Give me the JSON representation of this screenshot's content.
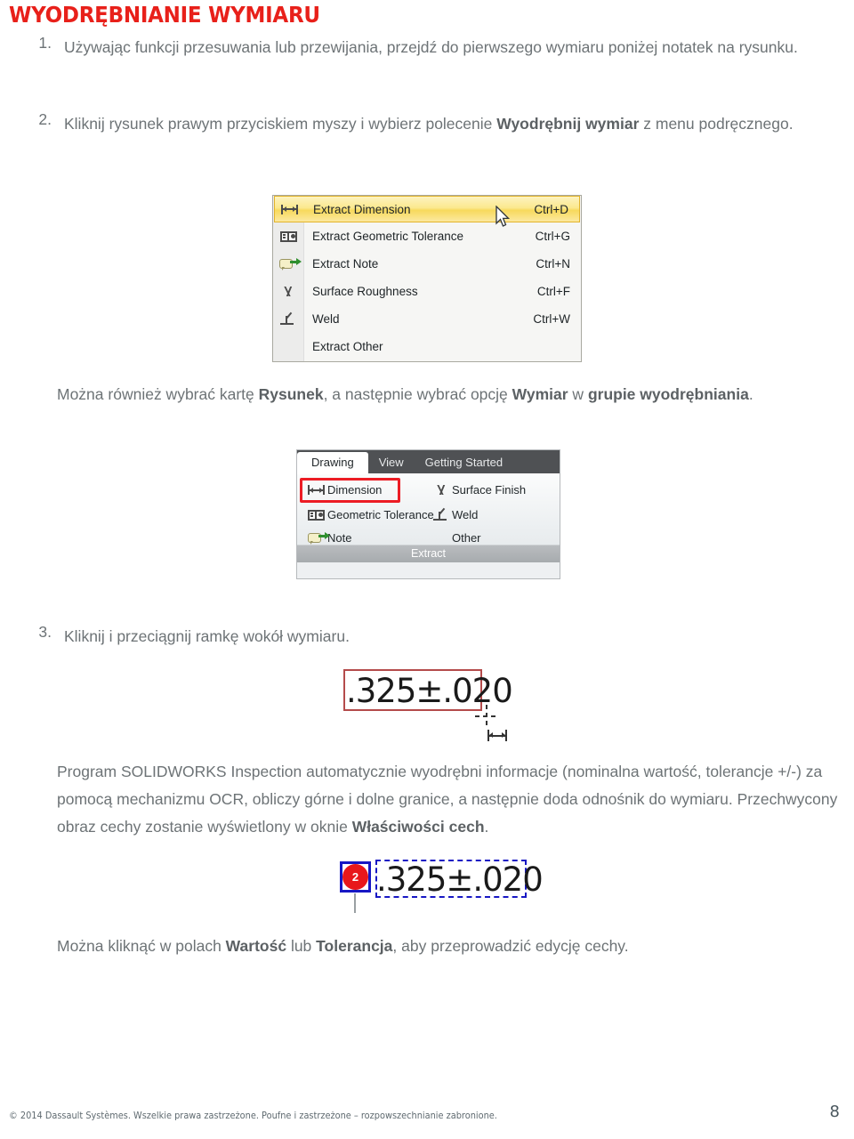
{
  "document": {
    "title": "WYODRĘBNIANIE WYMIARU",
    "title_color": "#e8201a",
    "page_number": "8",
    "footer": "© 2014 Dassault Systèmes. Wszelkie prawa zastrzeżone. Poufne i zastrzeżone – rozpowszechnianie zabronione."
  },
  "steps": [
    {
      "number": "1.",
      "text_before": "Używając funkcji przesuwania lub przewijania, przejdź do pierwszego wymiaru poniżej notatek na rysunku."
    },
    {
      "number": "2.",
      "text_before": "Kliknij rysunek prawym przyciskiem myszy i wybierz polecenie ",
      "bold": "Wyodrębnij wymiar",
      "text_after": " z menu podręcznego."
    },
    {
      "number": "3.",
      "text_before": "Kliknij i przeciągnij ramkę wokół wymiaru."
    }
  ],
  "paragraphs": {
    "ribbon_hint": {
      "p1": "Można również wybrać kartę ",
      "b1": "Rysunek",
      "p2": ", a następnie wybrać opcję ",
      "b2": "Wymiar",
      "p3": " w ",
      "b3": "grupie wyodrębniania",
      "p4": "."
    },
    "ocr_info": {
      "p1": "Program SOLIDWORKS Inspection automatycznie wyodrębni informacje (nominalna wartość, tolerancje +/-) za pomocą mechanizmu OCR, obliczy górne i dolne granice, a następnie doda odnośnik do wymiaru. Przechwycony obraz cechy zostanie wyświetlony w oknie ",
      "b1": "Właściwości cech",
      "p2": "."
    },
    "edit_hint": {
      "p1": "Można kliknąć w polach ",
      "b1": "Wartość",
      "p2": " lub ",
      "b2": "Tolerancja",
      "p3": ", aby przeprowadzić edycję cechy."
    }
  },
  "context_menu": {
    "highlight_color": "#f7d95c",
    "items": [
      {
        "icon": "dimension-icon",
        "label": "Extract Dimension",
        "shortcut": "Ctrl+D",
        "selected": true
      },
      {
        "icon": "geometric-tolerance-icon",
        "label": "Extract Geometric Tolerance",
        "shortcut": "Ctrl+G",
        "selected": false
      },
      {
        "icon": "note-icon",
        "label": "Extract Note",
        "shortcut": "Ctrl+N",
        "selected": false
      },
      {
        "icon": "surface-roughness-icon",
        "label": "Surface Roughness",
        "shortcut": "Ctrl+F",
        "selected": false
      },
      {
        "icon": "weld-icon",
        "label": "Weld",
        "shortcut": "Ctrl+W",
        "selected": false
      },
      {
        "icon": "none",
        "label": "Extract Other",
        "shortcut": "",
        "selected": false
      }
    ]
  },
  "ribbon": {
    "tabs": [
      {
        "label": "Drawing",
        "active": true
      },
      {
        "label": "View",
        "active": false
      },
      {
        "label": "Getting Started",
        "active": false
      }
    ],
    "commands": {
      "dimension": "Dimension",
      "geometric_tolerance": "Geometric Tolerance",
      "note": "Note",
      "surface_finish": "Surface Finish",
      "weld": "Weld",
      "other": "Other"
    },
    "group_label": "Extract",
    "highlight_color": "#ec1c24"
  },
  "callout_one": {
    "dimension_text": ".325±.020",
    "box_color": "#b44b4b"
  },
  "callout_two": {
    "balloon_number": "2",
    "dimension_text": ".325±.020",
    "balloon_color": "#e8171b",
    "selection_color": "#1717c4"
  }
}
